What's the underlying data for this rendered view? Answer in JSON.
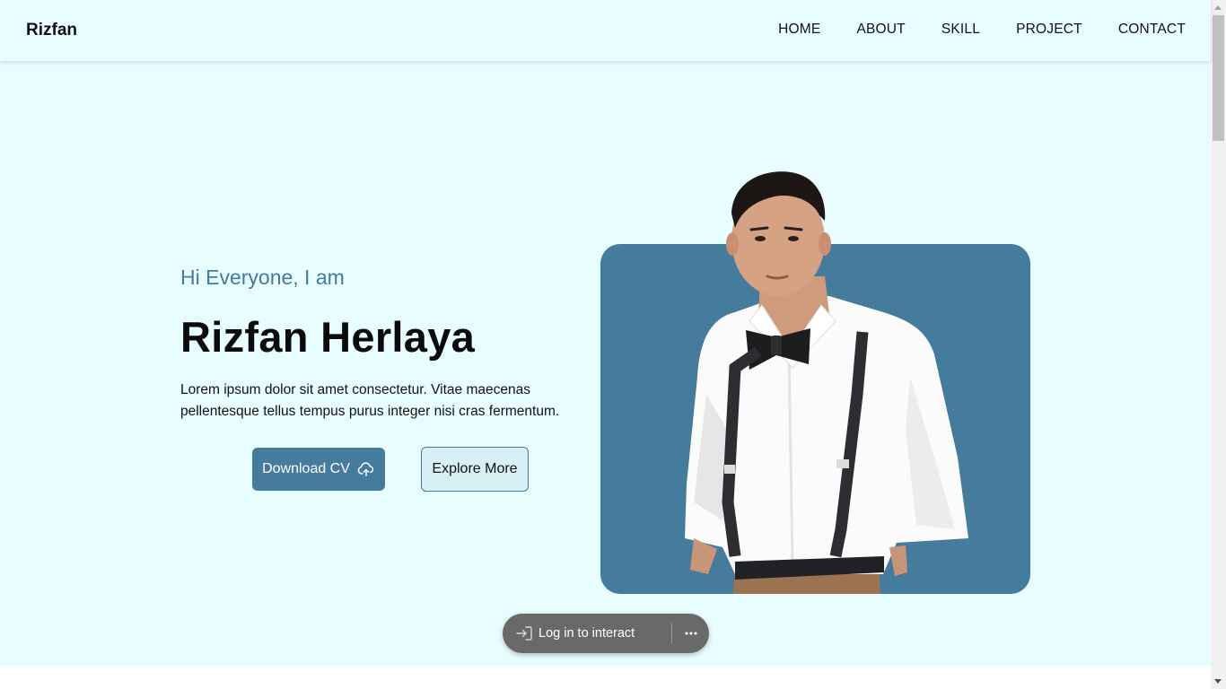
{
  "navbar": {
    "brand": "Rizfan",
    "links": [
      {
        "label": "HOME"
      },
      {
        "label": "ABOUT"
      },
      {
        "label": "SKILL"
      },
      {
        "label": "PROJECT"
      },
      {
        "label": "CONTACT"
      }
    ]
  },
  "hero": {
    "greeting": "Hi Everyone, I am",
    "name": "Rizfan Herlaya",
    "description": "Lorem ipsum dolor sit amet consectetur. Vitae maecenas pellentesque tellus tempus purus integer nisi cras fermentum.",
    "download_label": "Download CV",
    "download_icon": "cloud-upload-icon",
    "explore_label": "Explore More",
    "photo_card_color": "#457b9d"
  },
  "overlay": {
    "login_label": "Log in to interact",
    "login_icon": "sign-in-icon",
    "more_icon": "more-horizontal-icon"
  },
  "colors": {
    "page_bg": "#e8fdff",
    "accent": "#457b9d",
    "text": "#111111"
  }
}
